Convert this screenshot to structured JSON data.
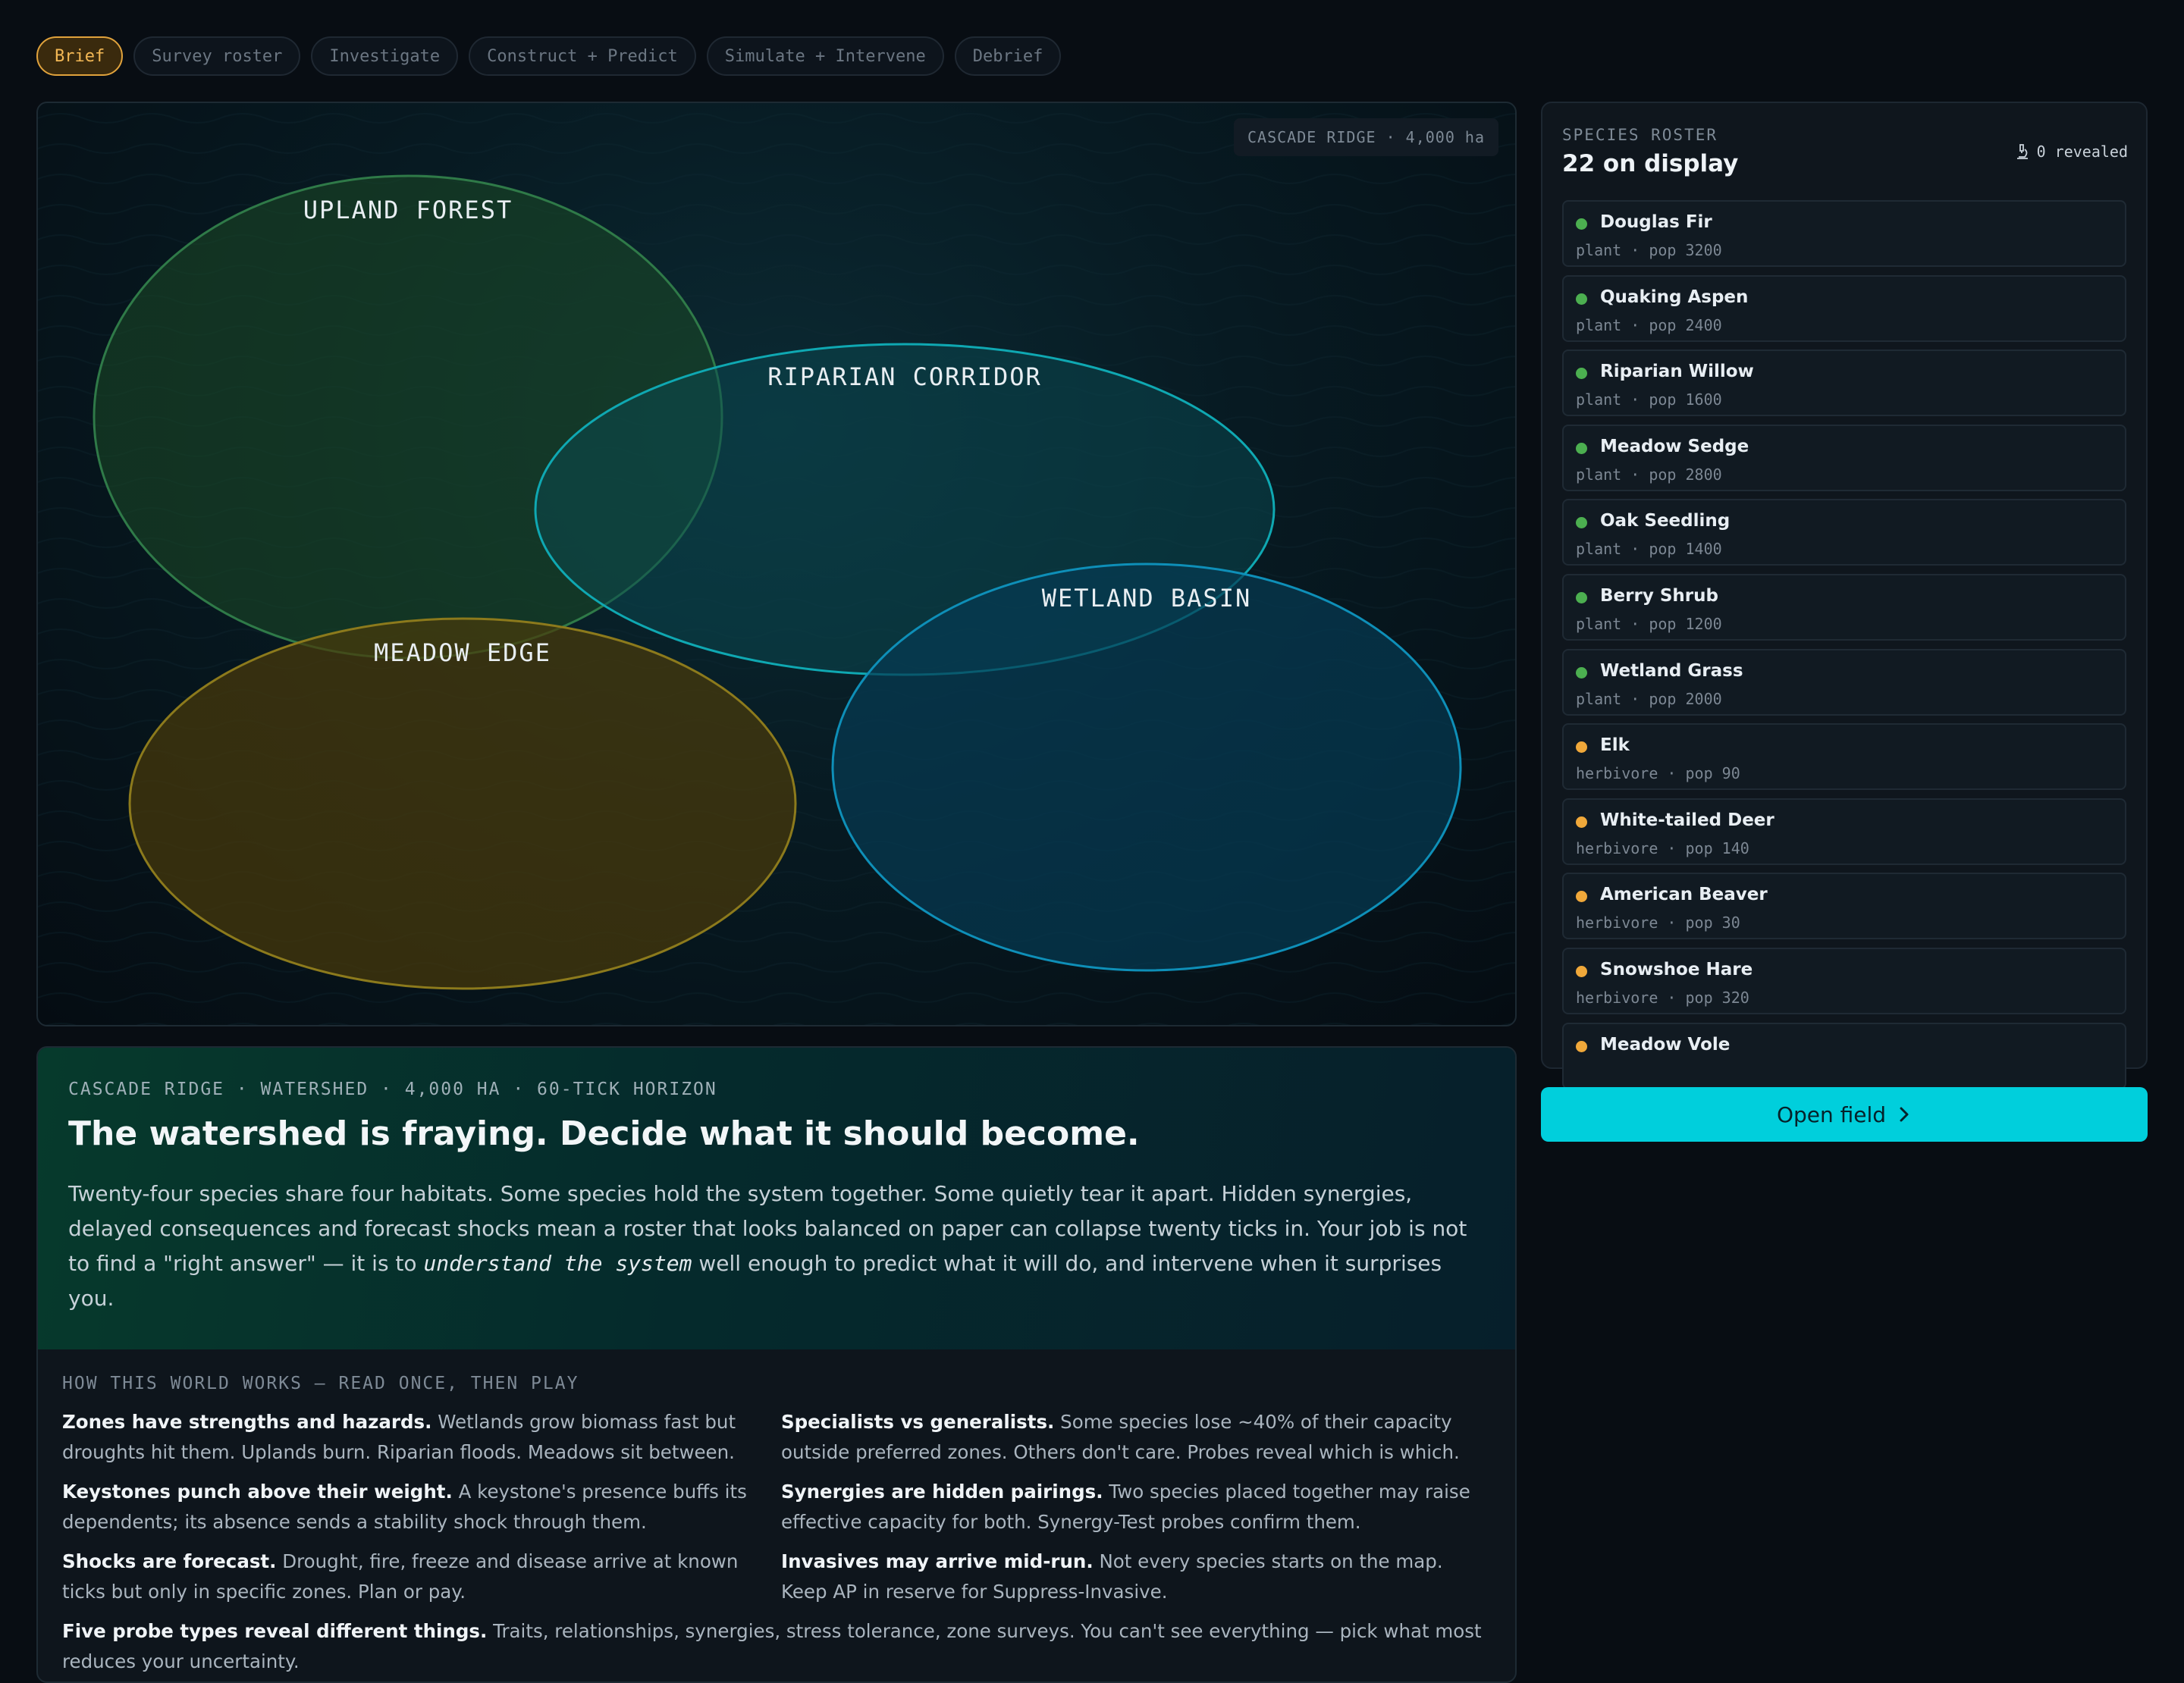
{
  "tabs": [
    {
      "label": "Brief",
      "active": true
    },
    {
      "label": "Survey roster"
    },
    {
      "label": "Investigate"
    },
    {
      "label": "Construct + Predict"
    },
    {
      "label": "Simulate + Intervene"
    },
    {
      "label": "Debrief"
    }
  ],
  "map": {
    "badge": "CASCADE RIDGE · 4,000 ha",
    "zones": [
      {
        "label": "UPLAND FOREST",
        "fill": "#1c4a26",
        "stroke": "#2f7a48"
      },
      {
        "label": "RIPARIAN CORRIDOR",
        "fill": "#0a4a52",
        "stroke": "#0fa8b2"
      },
      {
        "label": "MEADOW EDGE",
        "fill": "#4a3a0a",
        "stroke": "#8c7a1c"
      },
      {
        "label": "WETLAND BASIN",
        "fill": "#063a52",
        "stroke": "#0e8fb8"
      }
    ]
  },
  "roster": {
    "kicker": "SPECIES ROSTER",
    "title": "22 on display",
    "revealed": "0 revealed",
    "species": [
      {
        "name": "Douglas Fir",
        "meta": "plant · pop 3200",
        "color": "#4caf50"
      },
      {
        "name": "Quaking Aspen",
        "meta": "plant · pop 2400",
        "color": "#4caf50"
      },
      {
        "name": "Riparian Willow",
        "meta": "plant · pop 1600",
        "color": "#4caf50"
      },
      {
        "name": "Meadow Sedge",
        "meta": "plant · pop 2800",
        "color": "#4caf50"
      },
      {
        "name": "Oak Seedling",
        "meta": "plant · pop 1400",
        "color": "#4caf50"
      },
      {
        "name": "Berry Shrub",
        "meta": "plant · pop 1200",
        "color": "#4caf50"
      },
      {
        "name": "Wetland Grass",
        "meta": "plant · pop 2000",
        "color": "#4caf50"
      },
      {
        "name": "Elk",
        "meta": "herbivore · pop 90",
        "color": "#f0a83a"
      },
      {
        "name": "White-tailed Deer",
        "meta": "herbivore · pop 140",
        "color": "#f0a83a"
      },
      {
        "name": "American Beaver",
        "meta": "herbivore · pop 30",
        "color": "#f0a83a"
      },
      {
        "name": "Snowshoe Hare",
        "meta": "herbivore · pop 320",
        "color": "#f0a83a"
      },
      {
        "name": "Meadow Vole",
        "meta": "",
        "color": "#f0a83a"
      }
    ]
  },
  "open_button": "Open field",
  "brief": {
    "kicker": "CASCADE RIDGE · WATERSHED · 4,000 HA · 60-TICK HORIZON",
    "title": "The watershed is fraying. Decide what it should become.",
    "body_before": "Twenty-four species share four habitats. Some species hold the system together. Some quietly tear it apart. Hidden synergies, delayed consequences and forecast shocks mean a roster that looks balanced on paper can collapse twenty ticks in. Your job is not to find a \"right answer\" — it is to ",
    "body_em": "understand the system",
    "body_after": " well enough to predict what it will do, and intervene when it surprises you."
  },
  "rules": {
    "kicker": "HOW THIS WORLD WORKS — READ ONCE, THEN PLAY",
    "items": [
      {
        "head": "Zones have strengths and hazards.",
        "text": " Wetlands grow biomass fast but droughts hit them. Uplands burn. Riparian floods. Meadows sit between."
      },
      {
        "head": "Specialists vs generalists.",
        "text": " Some species lose ~40% of their capacity outside preferred zones. Others don't care. Probes reveal which is which."
      },
      {
        "head": "Keystones punch above their weight.",
        "text": " A keystone's presence buffs its dependents; its absence sends a stability shock through them."
      },
      {
        "head": "Synergies are hidden pairings.",
        "text": " Two species placed together may raise effective capacity for both. Synergy-Test probes confirm them."
      },
      {
        "head": "Shocks are forecast.",
        "text": " Drought, fire, freeze and disease arrive at known ticks but only in specific zones. Plan or pay."
      },
      {
        "head": "Invasives may arrive mid-run.",
        "text": " Not every species starts on the map. Keep AP in reserve for Suppress-Invasive."
      },
      {
        "head": "Five probe types reveal different things.",
        "text": " Traits, relationships, synergies, stress tolerance, zone surveys. You can't see everything — pick what most reduces your uncertainty."
      }
    ]
  }
}
